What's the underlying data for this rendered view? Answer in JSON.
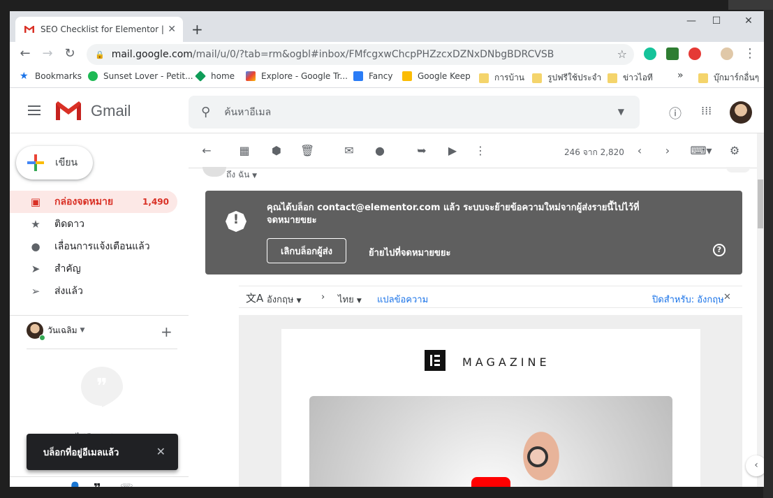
{
  "browser": {
    "tab_title": "SEO Checklist for Elementor | Ma",
    "url_host": "mail.google.com",
    "url_path": "/mail/u/0/?tab=rm&ogbl#inbox/FMfcgxwChcpPHZzcxDZNxDNbgBDRCVSB",
    "bookmarks": [
      {
        "label": "Bookmarks"
      },
      {
        "label": "Sunset Lover - Petit..."
      },
      {
        "label": "home"
      },
      {
        "label": "Explore - Google Tr..."
      },
      {
        "label": "Fancy"
      },
      {
        "label": "Google Keep"
      },
      {
        "label": "การบ้าน"
      },
      {
        "label": "รูปฟรีใช้ประจำ"
      },
      {
        "label": "ข่าวไอที"
      },
      {
        "label": "บุ๊กมาร์กอื่นๆ"
      }
    ],
    "overflow_label": "»"
  },
  "gmail": {
    "logo_text": "Gmail",
    "search_placeholder": "ค้นหาอีเมล",
    "compose_label": "เขียน",
    "nav": [
      {
        "label": "กล่องจดหมาย",
        "count": "1,490",
        "icon": "inbox-icon",
        "active": true
      },
      {
        "label": "ติดดาว",
        "icon": "star-icon"
      },
      {
        "label": "เลื่อนการแจ้งเตือนแล้ว",
        "icon": "clock-icon"
      },
      {
        "label": "สำคัญ",
        "icon": "important-icon"
      },
      {
        "label": "ส่งแล้ว",
        "icon": "send-icon"
      }
    ],
    "hangouts_user": "วันเฉลิม",
    "no_recent_chats": "ไม่มีแชทล่าสุด",
    "snackbar": "บล็อกที่อยู่อีเมลแล้ว",
    "pager": "246 จาก 2,820",
    "to_line": "ถึง ฉัน",
    "blocked_message": "คุณได้บล็อก contact@elementor.com แล้ว ระบบจะย้ายข้อความใหม่จากผู้ส่งรายนี้ไปไว้ที่จดหมายขยะ",
    "unblock_label": "เลิกบล็อกผู้ส่ง",
    "move_to_spam_label": "ย้ายไปที่จดหมายขยะ",
    "translate": {
      "from_lang": "อังกฤษ",
      "to_lang": "ไทย",
      "translate_label": "แปลข้อความ",
      "turn_off_label": "ปิดสำหรับ: อังกฤษ"
    },
    "email": {
      "brand": "MAGAZINE"
    }
  },
  "colors": {
    "gmail_red": "#d93025",
    "banner_bg": "#5f5f5f",
    "link_blue": "#1a73e8"
  }
}
